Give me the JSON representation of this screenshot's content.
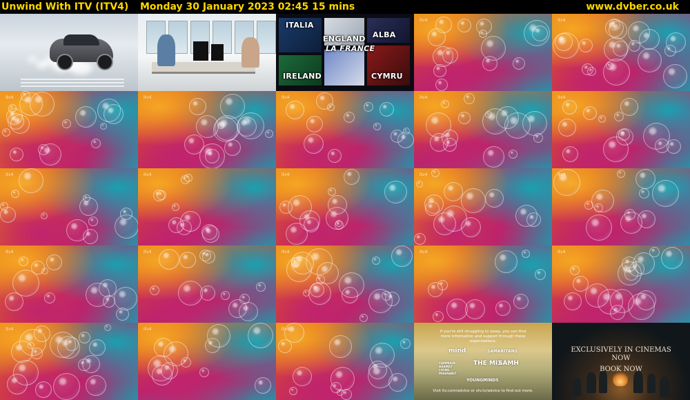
{
  "header": {
    "title": "Unwind With ITV (ITV4)",
    "datetime": "Monday 30 January 2023  02:45  15 mins",
    "site": "www.dvber.co.uk",
    "color": "#ffd700"
  },
  "thumbnails": [
    {
      "kind": "car"
    },
    {
      "kind": "office"
    },
    {
      "kind": "rugby"
    },
    {
      "kind": "bubbles",
      "logo": "itv4"
    },
    {
      "kind": "bubbles",
      "logo": "itv4"
    },
    {
      "kind": "bubbles",
      "logo": "itv4"
    },
    {
      "kind": "bubbles",
      "logo": "itv4"
    },
    {
      "kind": "bubbles",
      "logo": "itv4"
    },
    {
      "kind": "bubbles",
      "logo": "itv4"
    },
    {
      "kind": "bubbles",
      "logo": "itv4"
    },
    {
      "kind": "bubbles",
      "logo": "itv4"
    },
    {
      "kind": "bubbles",
      "logo": "itv4"
    },
    {
      "kind": "bubbles",
      "logo": "itv4"
    },
    {
      "kind": "bubbles",
      "logo": "itv4"
    },
    {
      "kind": "bubbles",
      "logo": "itv4"
    },
    {
      "kind": "bubbles",
      "logo": "itv4"
    },
    {
      "kind": "bubbles",
      "logo": "itv4"
    },
    {
      "kind": "bubbles",
      "logo": "itv4"
    },
    {
      "kind": "bubbles",
      "logo": "itv4"
    },
    {
      "kind": "bubbles",
      "logo": "itv4"
    },
    {
      "kind": "bubbles",
      "logo": "itv4"
    },
    {
      "kind": "bubbles",
      "logo": "itv4"
    },
    {
      "kind": "bubbles",
      "logo": "itv4"
    },
    {
      "kind": "support"
    },
    {
      "kind": "cinema"
    }
  ],
  "rugby": {
    "teams": [
      "ITALIA",
      "ENGLAND",
      "ALBA",
      "LA FRANCE",
      "IRELAND",
      "CYMRU"
    ]
  },
  "support": {
    "text_top": "If you're still struggling to sleep, you can find more information and support through these organisations.",
    "logos": [
      "mind",
      "SAMARITANS",
      "CAMPAIGN AGAINST LIVING MISERABLY",
      "THE MIX",
      "SAMH",
      "YOUNGMINDS"
    ],
    "text_bottom": "Visit itv.com/advice or stv.tv/advice to find out more."
  },
  "cinema": {
    "line1": "EXCLUSIVELY IN CINEMAS",
    "line2": "NOW",
    "line3": "BOOK NOW"
  },
  "colors": {
    "bubble_gradient": [
      "#e8841a",
      "#d23a3a",
      "#a82a7a",
      "#1b8fa0"
    ]
  }
}
